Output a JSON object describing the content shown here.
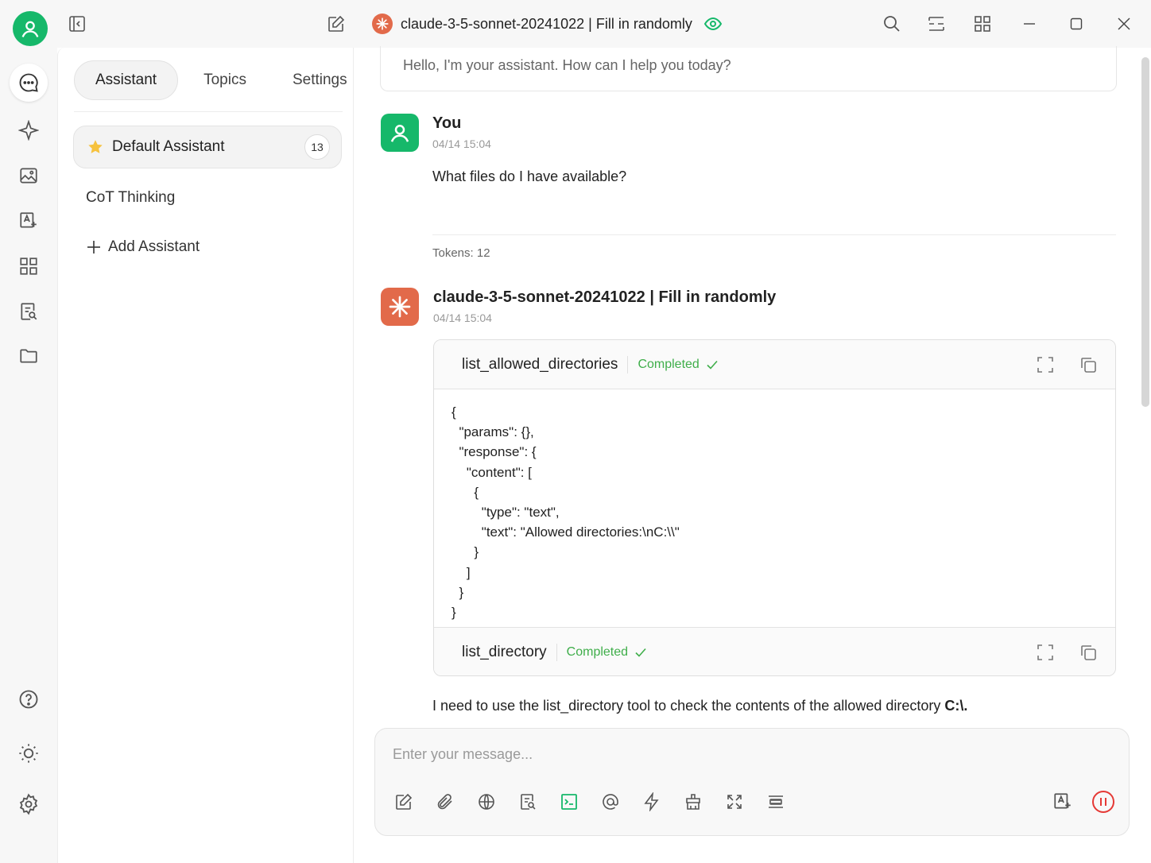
{
  "window": {
    "title": "claude-3-5-sonnet-20241022 | Fill in randomly"
  },
  "panel": {
    "tabs": [
      {
        "label": "Assistant"
      },
      {
        "label": "Topics"
      },
      {
        "label": "Settings"
      }
    ],
    "assistants": [
      {
        "name": "Default Assistant",
        "count": "13"
      },
      {
        "name": "CoT Thinking"
      }
    ],
    "add_label": "Add Assistant"
  },
  "chat": {
    "greeting": "Hello, I'm your assistant. How can I help you today?",
    "user": {
      "name": "You",
      "time": "04/14 15:04",
      "text": "What files do I have available?",
      "tokens": "Tokens: 12"
    },
    "assistant": {
      "name": "claude-3-5-sonnet-20241022 | Fill in randomly",
      "time": "04/14 15:04",
      "tools": [
        {
          "name": "list_allowed_directories",
          "status": "Completed",
          "output": "{\n  \"params\": {},\n  \"response\": {\n    \"content\": [\n      {\n        \"type\": \"text\",\n        \"text\": \"Allowed directories:\\nC:\\\\\"\n      }\n    ]\n  }\n}"
        },
        {
          "name": "list_directory",
          "status": "Completed"
        }
      ],
      "answer_text": "I need to use the list_directory tool to check the contents of the allowed directory ",
      "answer_bold": "C:\\."
    }
  },
  "input": {
    "placeholder": "Enter your message..."
  },
  "colors": {
    "brand_green": "#16b86a",
    "claude_orange": "#e26a4a",
    "status_green": "#3fae4a",
    "stop_red": "#e53935"
  },
  "icons": [
    "user-icon",
    "sidebar-toggle-icon",
    "new-chat-icon",
    "eye-icon",
    "search-icon",
    "sidebar-layout-icon",
    "grid-icon",
    "minimize-icon",
    "maximize-icon",
    "close-icon",
    "chat-icon",
    "sparkle-icon",
    "image-icon",
    "translate-icon",
    "apps-icon",
    "knowledge-icon",
    "folder-icon",
    "help-icon",
    "sun-icon",
    "gear-icon",
    "star-icon",
    "plus-icon",
    "expand-icon",
    "copy-icon",
    "check-icon",
    "paperclip-icon",
    "globe-icon",
    "terminal-icon",
    "at-icon",
    "bolt-icon",
    "clear-icon",
    "fullscreen-icon",
    "list-icon",
    "stop-icon"
  ]
}
